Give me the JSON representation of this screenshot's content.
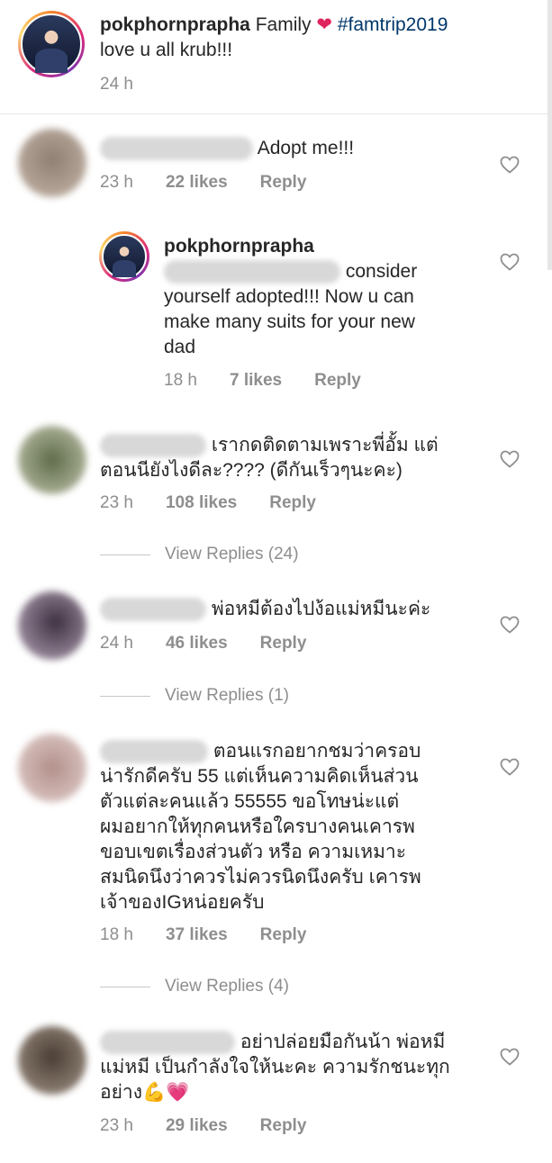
{
  "caption": {
    "username": "pokphornprapha",
    "text": "Family",
    "heart": "❤",
    "hashtag": "#famtrip2019",
    "line2": "love u all krub!!!",
    "time": "24 h"
  },
  "comments": [
    {
      "text": "Adopt me!!!",
      "time": "23 h",
      "likes": "22 likes",
      "reply": "Reply"
    },
    {
      "username": "pokphornprapha",
      "line1": "consider",
      "line2": "yourself adopted!!! Now u can",
      "line3": "make many suits for your new",
      "line4": "dad",
      "time": "18 h",
      "likes": "7 likes",
      "reply": "Reply"
    },
    {
      "line1": "เรากดติดตามเพราะพี่อั้ม แต่",
      "line2": "ตอนนียังไงดีละ???? (ดีกันเร็วๆนะคะ)",
      "time": "23 h",
      "likes": "108 likes",
      "reply": "Reply",
      "view_replies": "View Replies (24)"
    },
    {
      "line1": "พ่อหมีต้องไปง้อแม่หมีนะค่ะ",
      "time": "24 h",
      "likes": "46 likes",
      "reply": "Reply",
      "view_replies": "View Replies (1)"
    },
    {
      "line1": "ตอนแรกอยากชมว่าครอบ",
      "line2": "น่ารักดีครับ 55 แต่เห็นความคิดเห็นส่วน",
      "line3": "ตัวแต่ละคนแล้ว 55555 ขอโทษน่ะแต่",
      "line4": "ผมอยากให้ทุกคนหรือใครบางคนเคารพ",
      "line5": "ขอบเขตเรื่องส่วนตัว หรือ ความเหมาะ",
      "line6": "สมนิดนึงว่าควรไม่ควรนิดนึงครับ เคารพ",
      "line7": "เจ้าของIGหน่อยครับ",
      "time": "18 h",
      "likes": "37 likes",
      "reply": "Reply",
      "view_replies": "View Replies (4)"
    },
    {
      "line1": "อย่าปล่อยมือกันน้า พ่อหมี",
      "line2": "แม่หมี เป็นกำลังใจให้นะคะ ความรักชนะทุก",
      "line3": "อย่าง",
      "emoji": "💪💗",
      "time": "23 h",
      "likes": "29 likes",
      "reply": "Reply"
    }
  ]
}
